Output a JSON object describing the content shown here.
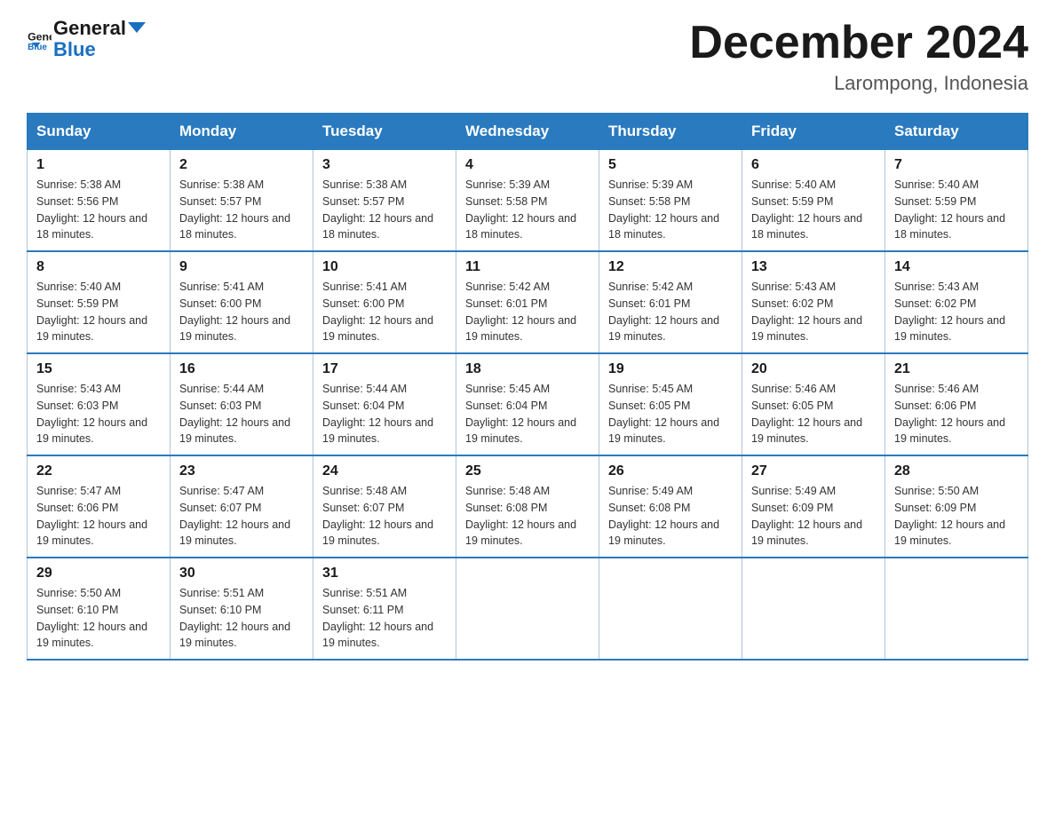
{
  "logo": {
    "text_general": "General",
    "text_blue": "Blue"
  },
  "title": "December 2024",
  "location": "Larompong, Indonesia",
  "days_of_week": [
    "Sunday",
    "Monday",
    "Tuesday",
    "Wednesday",
    "Thursday",
    "Friday",
    "Saturday"
  ],
  "weeks": [
    [
      {
        "day": "1",
        "sunrise": "5:38 AM",
        "sunset": "5:56 PM",
        "daylight": "12 hours and 18 minutes."
      },
      {
        "day": "2",
        "sunrise": "5:38 AM",
        "sunset": "5:57 PM",
        "daylight": "12 hours and 18 minutes."
      },
      {
        "day": "3",
        "sunrise": "5:38 AM",
        "sunset": "5:57 PM",
        "daylight": "12 hours and 18 minutes."
      },
      {
        "day": "4",
        "sunrise": "5:39 AM",
        "sunset": "5:58 PM",
        "daylight": "12 hours and 18 minutes."
      },
      {
        "day": "5",
        "sunrise": "5:39 AM",
        "sunset": "5:58 PM",
        "daylight": "12 hours and 18 minutes."
      },
      {
        "day": "6",
        "sunrise": "5:40 AM",
        "sunset": "5:59 PM",
        "daylight": "12 hours and 18 minutes."
      },
      {
        "day": "7",
        "sunrise": "5:40 AM",
        "sunset": "5:59 PM",
        "daylight": "12 hours and 18 minutes."
      }
    ],
    [
      {
        "day": "8",
        "sunrise": "5:40 AM",
        "sunset": "5:59 PM",
        "daylight": "12 hours and 19 minutes."
      },
      {
        "day": "9",
        "sunrise": "5:41 AM",
        "sunset": "6:00 PM",
        "daylight": "12 hours and 19 minutes."
      },
      {
        "day": "10",
        "sunrise": "5:41 AM",
        "sunset": "6:00 PM",
        "daylight": "12 hours and 19 minutes."
      },
      {
        "day": "11",
        "sunrise": "5:42 AM",
        "sunset": "6:01 PM",
        "daylight": "12 hours and 19 minutes."
      },
      {
        "day": "12",
        "sunrise": "5:42 AM",
        "sunset": "6:01 PM",
        "daylight": "12 hours and 19 minutes."
      },
      {
        "day": "13",
        "sunrise": "5:43 AM",
        "sunset": "6:02 PM",
        "daylight": "12 hours and 19 minutes."
      },
      {
        "day": "14",
        "sunrise": "5:43 AM",
        "sunset": "6:02 PM",
        "daylight": "12 hours and 19 minutes."
      }
    ],
    [
      {
        "day": "15",
        "sunrise": "5:43 AM",
        "sunset": "6:03 PM",
        "daylight": "12 hours and 19 minutes."
      },
      {
        "day": "16",
        "sunrise": "5:44 AM",
        "sunset": "6:03 PM",
        "daylight": "12 hours and 19 minutes."
      },
      {
        "day": "17",
        "sunrise": "5:44 AM",
        "sunset": "6:04 PM",
        "daylight": "12 hours and 19 minutes."
      },
      {
        "day": "18",
        "sunrise": "5:45 AM",
        "sunset": "6:04 PM",
        "daylight": "12 hours and 19 minutes."
      },
      {
        "day": "19",
        "sunrise": "5:45 AM",
        "sunset": "6:05 PM",
        "daylight": "12 hours and 19 minutes."
      },
      {
        "day": "20",
        "sunrise": "5:46 AM",
        "sunset": "6:05 PM",
        "daylight": "12 hours and 19 minutes."
      },
      {
        "day": "21",
        "sunrise": "5:46 AM",
        "sunset": "6:06 PM",
        "daylight": "12 hours and 19 minutes."
      }
    ],
    [
      {
        "day": "22",
        "sunrise": "5:47 AM",
        "sunset": "6:06 PM",
        "daylight": "12 hours and 19 minutes."
      },
      {
        "day": "23",
        "sunrise": "5:47 AM",
        "sunset": "6:07 PM",
        "daylight": "12 hours and 19 minutes."
      },
      {
        "day": "24",
        "sunrise": "5:48 AM",
        "sunset": "6:07 PM",
        "daylight": "12 hours and 19 minutes."
      },
      {
        "day": "25",
        "sunrise": "5:48 AM",
        "sunset": "6:08 PM",
        "daylight": "12 hours and 19 minutes."
      },
      {
        "day": "26",
        "sunrise": "5:49 AM",
        "sunset": "6:08 PM",
        "daylight": "12 hours and 19 minutes."
      },
      {
        "day": "27",
        "sunrise": "5:49 AM",
        "sunset": "6:09 PM",
        "daylight": "12 hours and 19 minutes."
      },
      {
        "day": "28",
        "sunrise": "5:50 AM",
        "sunset": "6:09 PM",
        "daylight": "12 hours and 19 minutes."
      }
    ],
    [
      {
        "day": "29",
        "sunrise": "5:50 AM",
        "sunset": "6:10 PM",
        "daylight": "12 hours and 19 minutes."
      },
      {
        "day": "30",
        "sunrise": "5:51 AM",
        "sunset": "6:10 PM",
        "daylight": "12 hours and 19 minutes."
      },
      {
        "day": "31",
        "sunrise": "5:51 AM",
        "sunset": "6:11 PM",
        "daylight": "12 hours and 19 minutes."
      },
      null,
      null,
      null,
      null
    ]
  ]
}
